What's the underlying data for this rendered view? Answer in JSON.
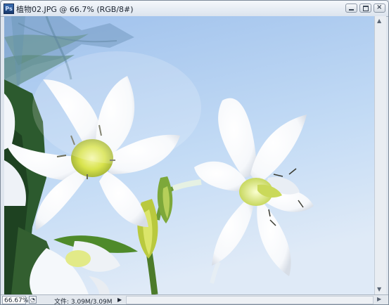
{
  "window": {
    "title": "植物02.JPG @ 66.7% (RGB/8#)",
    "app_icon": "Ps",
    "buttons": {
      "minimize": "minimize-icon",
      "maximize": "maximize-icon",
      "close": "close-icon"
    }
  },
  "status_bar": {
    "zoom": "66.67%",
    "doc_info": "文件: 3.09M/3.09M"
  },
  "image": {
    "subject": "white lily flowers against blue sky",
    "colors": {
      "sky_top": "#a9c8ee",
      "sky_bottom": "#d7e6f6",
      "foliage": "#2f5a2a",
      "petal": "#ffffff",
      "center": "#d6e04a"
    }
  }
}
